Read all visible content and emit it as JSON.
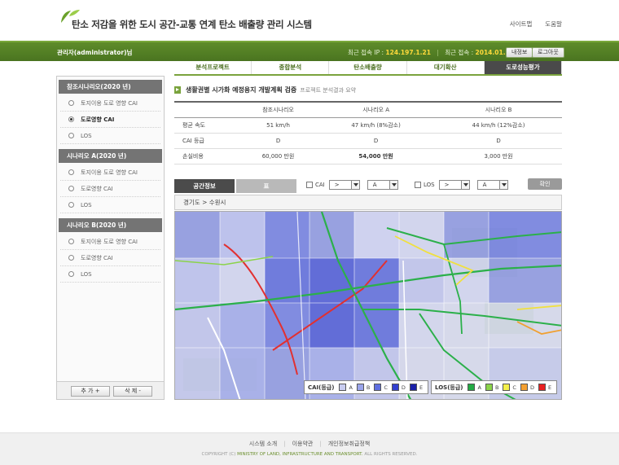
{
  "header": {
    "title": "탄소 저감을 위한 도시 공간-교통 연계 탄소 배출량 관리 시스템",
    "links": [
      "사이트맵",
      "도움말"
    ]
  },
  "admin_bar": {
    "user": "관리자(administrator)님",
    "last_ip_label": "최근 접속 IP :",
    "last_ip": "124.197.1.21",
    "last_login_label": "최근 접속 :",
    "last_login": "2014.01.16",
    "my_info": "내정보",
    "logout": "로그아웃"
  },
  "tabs": [
    {
      "label": "분석프로젝트",
      "active": false
    },
    {
      "label": "종합분석",
      "active": false
    },
    {
      "label": "탄소배출량",
      "active": false
    },
    {
      "label": "대기확산",
      "active": false
    },
    {
      "label": "도로성능평가",
      "active": true
    }
  ],
  "scenarios": [
    {
      "title": "참조시나리오(2020 년)",
      "items": [
        {
          "label": "토지이용 도로 영향 CAI",
          "selected": false
        },
        {
          "label": "도로영향 CAI",
          "selected": true
        },
        {
          "label": "LOS",
          "selected": false
        }
      ]
    },
    {
      "title": "시나리오 A(2020 년)",
      "items": [
        {
          "label": "토지이용 도로 영향 CAI",
          "selected": false
        },
        {
          "label": "도로영향 CAI",
          "selected": false
        },
        {
          "label": "LOS",
          "selected": false
        }
      ]
    },
    {
      "title": "시나리오 B(2020 년)",
      "items": [
        {
          "label": "토지이용 도로 영향 CAI",
          "selected": false
        },
        {
          "label": "도로영향 CAI",
          "selected": false
        },
        {
          "label": "LOS",
          "selected": false
        }
      ]
    }
  ],
  "left_footer": {
    "add": "추 가 +",
    "delete": "삭 제 -"
  },
  "section": {
    "title": "생활권별 시가화 예정용지 개발계획 검증",
    "subtitle": "프로젝트 분석결과 요약"
  },
  "comparison": {
    "columns": [
      "",
      "참조시나리오",
      "시나리오 A",
      "시나리오 B"
    ],
    "rows": [
      {
        "label": "평균 속도",
        "values": [
          "51 km/h",
          "47 km/h (8%감소)",
          "44 km/h (12%감소)"
        ],
        "bold": false
      },
      {
        "label": "CAI 등급",
        "values": [
          "D",
          "D",
          "D"
        ],
        "bold": false
      },
      {
        "label": "손실비용",
        "values": [
          "60,000 만원",
          "54,000 만원",
          "3,000 만원"
        ],
        "bold": true
      }
    ]
  },
  "map_tabs": {
    "spatial": "공간정보",
    "table": "표"
  },
  "filters": {
    "cai": {
      "label": "CAI",
      "op": ">",
      "grade": "A"
    },
    "los": {
      "label": "LOS",
      "op": ">",
      "grade": "A"
    },
    "confirm": "확인"
  },
  "breadcrumb": "경기도 > 수원시",
  "legend_cai": {
    "title": "CAI(등급)",
    "items": [
      {
        "label": "A",
        "color": "#c8ccf0"
      },
      {
        "label": "B",
        "color": "#9aa4ea"
      },
      {
        "label": "C",
        "color": "#5f6fe0"
      },
      {
        "label": "D",
        "color": "#3240d0"
      },
      {
        "label": "E",
        "color": "#1a20a8"
      }
    ]
  },
  "legend_los": {
    "title": "LOS(등급)",
    "items": [
      {
        "label": "A",
        "color": "#22aa44"
      },
      {
        "label": "B",
        "color": "#8bd34a"
      },
      {
        "label": "C",
        "color": "#f4f04a"
      },
      {
        "label": "D",
        "color": "#f4a030"
      },
      {
        "label": "E",
        "color": "#e82020"
      }
    ]
  },
  "footer": {
    "links": [
      "시스템 소개",
      "이용약관",
      "개인정보취급정책"
    ],
    "copyright_prefix": "COPYRIGHT (C)",
    "copyright_org": "MINISTRY OF LAND, INFRASTRUCTURE AND TRANSPORT.",
    "copyright_suffix": "ALL RIGHTS RESERVED."
  }
}
